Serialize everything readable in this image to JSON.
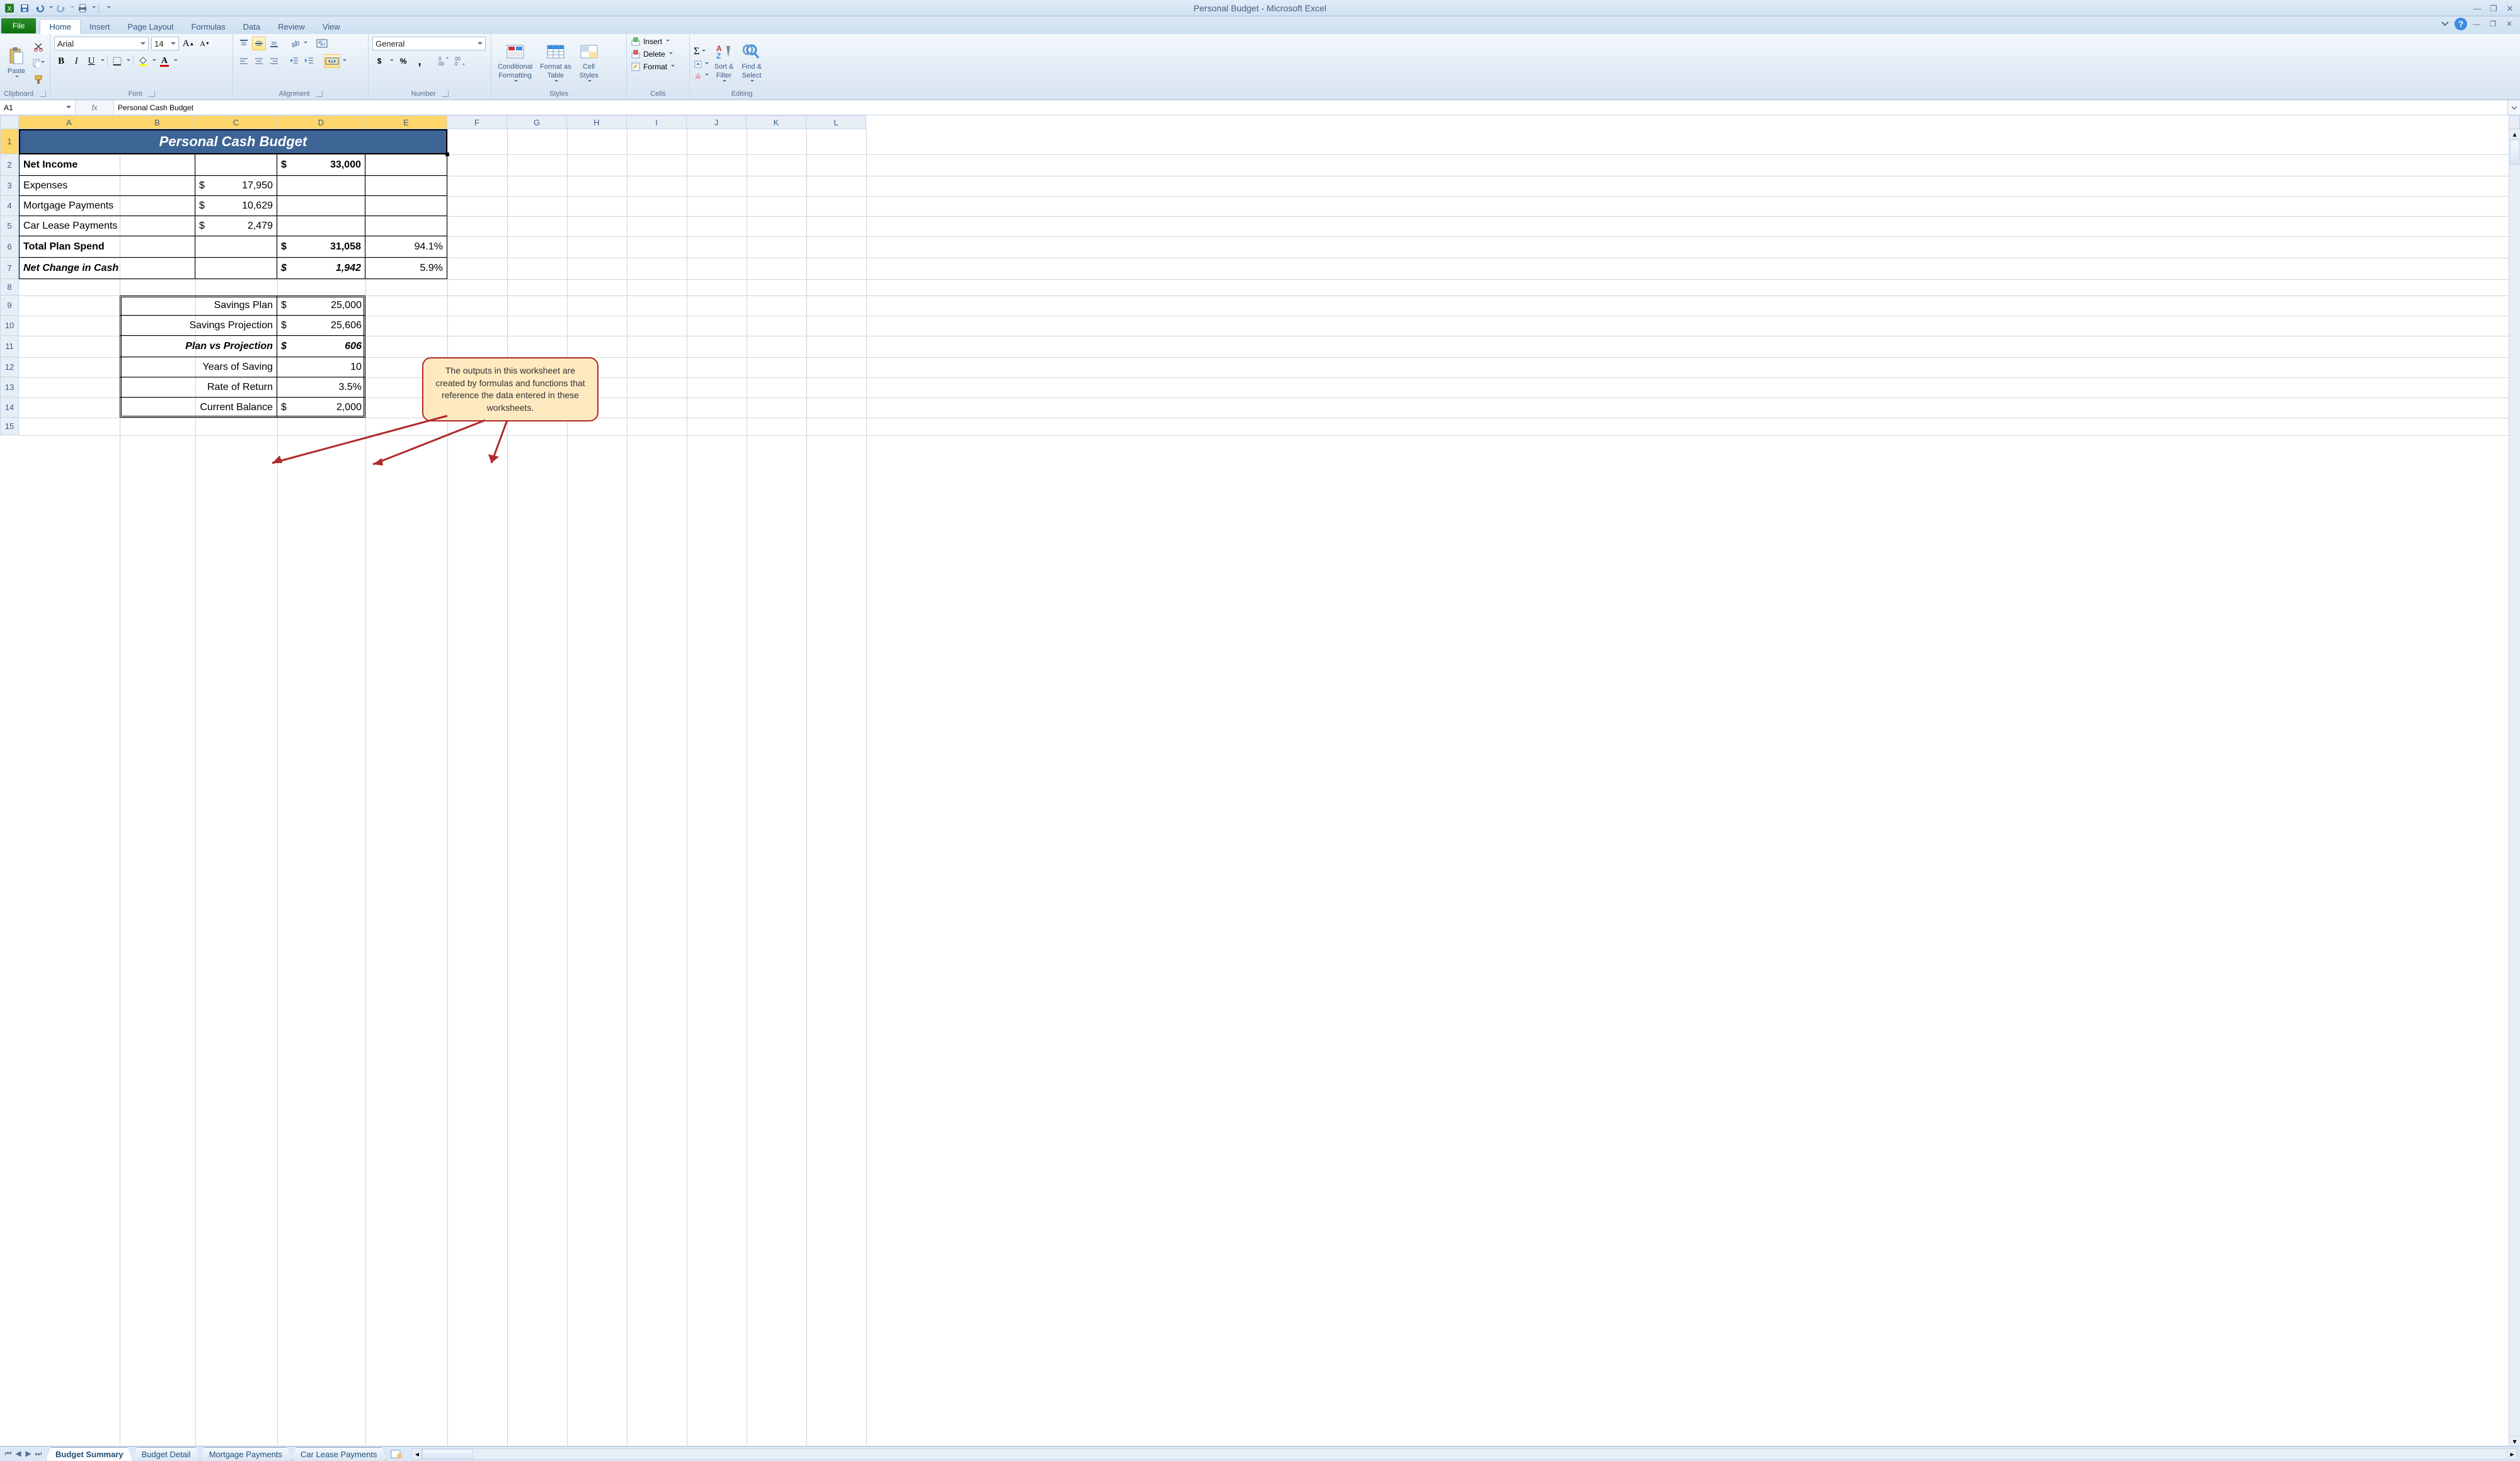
{
  "app": {
    "title": "Personal Budget - Microsoft Excel"
  },
  "qat": {
    "excel_icon": "excel-icon",
    "save_icon": "save-icon",
    "undo_icon": "undo-icon",
    "redo_icon": "redo-icon",
    "print_icon": "print-icon",
    "customize_icon": "customize-dropdown"
  },
  "ribbon": {
    "file_tab": "File",
    "tabs": [
      "Home",
      "Insert",
      "Page Layout",
      "Formulas",
      "Data",
      "Review",
      "View"
    ],
    "active_tab": "Home",
    "groups": {
      "clipboard": {
        "label": "Clipboard",
        "paste": "Paste"
      },
      "font": {
        "label": "Font",
        "font_name": "Arial",
        "font_size": "14",
        "bold": "B",
        "italic": "I",
        "underline": "U"
      },
      "alignment": {
        "label": "Alignment"
      },
      "number": {
        "label": "Number",
        "format": "General"
      },
      "styles": {
        "label": "Styles",
        "conditional": "Conditional\nFormatting",
        "format_table": "Format as\nTable",
        "cell_styles": "Cell\nStyles"
      },
      "cells": {
        "label": "Cells",
        "insert": "Insert",
        "delete": "Delete",
        "format": "Format"
      },
      "editing": {
        "label": "Editing",
        "sort": "Sort &\nFilter",
        "find": "Find &\nSelect"
      }
    }
  },
  "namebox": {
    "value": "A1"
  },
  "formula_bar": {
    "fx": "fx",
    "value": "Personal Cash Budget"
  },
  "columns": [
    "A",
    "B",
    "C",
    "D",
    "E",
    "F",
    "G",
    "H",
    "I",
    "J",
    "K",
    "L"
  ],
  "rows": [
    1,
    2,
    3,
    4,
    5,
    6,
    7,
    8,
    9,
    10,
    11,
    12,
    13,
    14,
    15
  ],
  "sheet": {
    "title": "Personal Cash Budget",
    "r2": {
      "a": "Net Income",
      "d": "$   33,000"
    },
    "r3": {
      "a": "Expenses",
      "c": "$   17,950"
    },
    "r4": {
      "a": "Mortgage Payments",
      "c": "$   10,629"
    },
    "r5": {
      "a": "Car Lease Payments",
      "c": "$     2,479"
    },
    "r6": {
      "a": "Total Plan Spend",
      "d": "$   31,058",
      "e": "94.1%"
    },
    "r7": {
      "a": "Net Change in Cash",
      "d": "$     1,942",
      "e": "5.9%"
    },
    "r9": {
      "label": "Savings Plan",
      "d": "$    25,000"
    },
    "r10": {
      "label": "Savings Projection",
      "d": "$    25,606"
    },
    "r11": {
      "label": "Plan vs Projection",
      "d": "$          606"
    },
    "r12": {
      "label": "Years of Saving",
      "d": "10"
    },
    "r13": {
      "label": "Rate of Return",
      "d": "3.5%"
    },
    "r14": {
      "label": "Current Balance",
      "d": "$       2,000"
    }
  },
  "callout": {
    "text": "The outputs in this worksheet are created by formulas and functions that reference the data entered in these worksheets."
  },
  "sheet_tabs": {
    "tabs": [
      "Budget Summary",
      "Budget Detail",
      "Mortgage Payments",
      "Car Lease Payments"
    ],
    "active": "Budget Summary"
  },
  "chart_data": {
    "type": "table",
    "title": "Personal Cash Budget",
    "rows": [
      {
        "label": "Net Income",
        "amount": 33000
      },
      {
        "label": "Expenses",
        "amount": 17950
      },
      {
        "label": "Mortgage Payments",
        "amount": 10629
      },
      {
        "label": "Car Lease Payments",
        "amount": 2479
      },
      {
        "label": "Total Plan Spend",
        "amount": 31058,
        "pct": 0.941
      },
      {
        "label": "Net Change in Cash",
        "amount": 1942,
        "pct": 0.059
      },
      {
        "label": "Savings Plan",
        "amount": 25000
      },
      {
        "label": "Savings Projection",
        "amount": 25606
      },
      {
        "label": "Plan vs Projection",
        "amount": 606
      },
      {
        "label": "Years of Saving",
        "value": 10
      },
      {
        "label": "Rate of Return",
        "value": 0.035
      },
      {
        "label": "Current Balance",
        "amount": 2000
      }
    ]
  }
}
